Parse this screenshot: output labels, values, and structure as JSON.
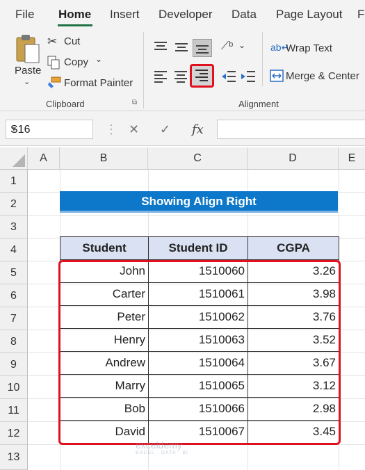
{
  "menu": {
    "file": "File",
    "home": "Home",
    "insert": "Insert",
    "developer": "Developer",
    "data": "Data",
    "page_layout": "Page Layout",
    "next": "F"
  },
  "clipboard": {
    "paste": "Paste",
    "cut": "Cut",
    "copy": "Copy",
    "format_painter": "Format Painter",
    "label": "Clipboard"
  },
  "alignment": {
    "wrap_text": "Wrap Text",
    "merge_center": "Merge & Center",
    "label": "Alignment",
    "highlight_color": "#e0101e"
  },
  "formula_bar": {
    "name_box": "S16",
    "cancel": "✕",
    "enter": "✓",
    "fx": "fx",
    "formula": ""
  },
  "columns": [
    "A",
    "B",
    "C",
    "D",
    "E"
  ],
  "rows": [
    "1",
    "2",
    "3",
    "4",
    "5",
    "6",
    "7",
    "8",
    "9",
    "10",
    "11",
    "12",
    "13"
  ],
  "sheet": {
    "title": "Showing Align Right",
    "title_color": "#0d78c9",
    "headers": [
      "Student",
      "Student ID",
      "CGPA"
    ],
    "records": [
      [
        "John",
        "1510060",
        "3.26"
      ],
      [
        "Carter",
        "1510061",
        "3.98"
      ],
      [
        "Peter",
        "1510062",
        "3.76"
      ],
      [
        "Henry",
        "1510063",
        "3.52"
      ],
      [
        "Andrew",
        "1510064",
        "3.67"
      ],
      [
        "Marry",
        "1510065",
        "3.12"
      ],
      [
        "Bob",
        "1510066",
        "2.98"
      ],
      [
        "David",
        "1510067",
        "3.45"
      ]
    ]
  },
  "watermark": {
    "name": "exceldemy",
    "tagline": "EXCEL · DATA · BI"
  }
}
